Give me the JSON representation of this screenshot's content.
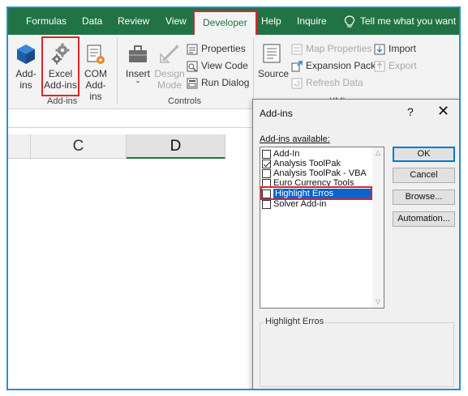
{
  "ribbon_tabs": [
    {
      "label": "Formulas"
    },
    {
      "label": "Data"
    },
    {
      "label": "Review"
    },
    {
      "label": "View"
    },
    {
      "label": "Developer",
      "active": true
    },
    {
      "label": "Help"
    },
    {
      "label": "Inquire"
    },
    {
      "label": "Tell me what you want to do",
      "icon": "lightbulb-icon"
    }
  ],
  "ribbon": {
    "addins_group": {
      "name": "Add-ins",
      "addins_btn": {
        "line1": "Add-",
        "line2": "ins"
      },
      "excel_addins_btn": {
        "line1": "Excel",
        "line2": "Add-ins"
      },
      "com_addins_btn": {
        "line1": "COM",
        "line2": "Add-ins"
      }
    },
    "controls_group": {
      "name": "Controls",
      "insert_btn": {
        "label": "Insert",
        "arrow": "ˇ"
      },
      "design_mode_btn": {
        "line1": "Design",
        "line2": "Mode"
      },
      "properties": "Properties",
      "view_code": "View Code",
      "run_dialog": "Run Dialog"
    },
    "xml_group": {
      "name": "XML",
      "source": "Source",
      "map_properties": "Map Properties",
      "expansion_packs": "Expansion Packs",
      "refresh_data": "Refresh Data",
      "import": "Import",
      "export": "Export"
    }
  },
  "columns": [
    "C",
    "D"
  ],
  "dialog": {
    "title": "Add-ins",
    "help": "?",
    "close": "✕",
    "available_label": "Add-ins available:",
    "items": [
      {
        "label": "Add-In",
        "checked": false
      },
      {
        "label": "Analysis ToolPak",
        "checked": true
      },
      {
        "label": "Analysis ToolPak - VBA",
        "checked": false
      },
      {
        "label": "Euro Currency Tools",
        "checked": false
      },
      {
        "label": "Highlight Erros",
        "checked": false,
        "selected": true
      },
      {
        "label": "Solver Add-in",
        "checked": false
      }
    ],
    "buttons": {
      "ok": "OK",
      "cancel": "Cancel",
      "browse": "Browse...",
      "automation": "Automation..."
    },
    "description_title": "Highlight Erros",
    "description_text": ""
  },
  "colors": {
    "excel_green": "#217346",
    "highlight_red": "#d9262c",
    "selection_blue": "#0a64c9",
    "frame_blue": "#2a8dd4"
  }
}
